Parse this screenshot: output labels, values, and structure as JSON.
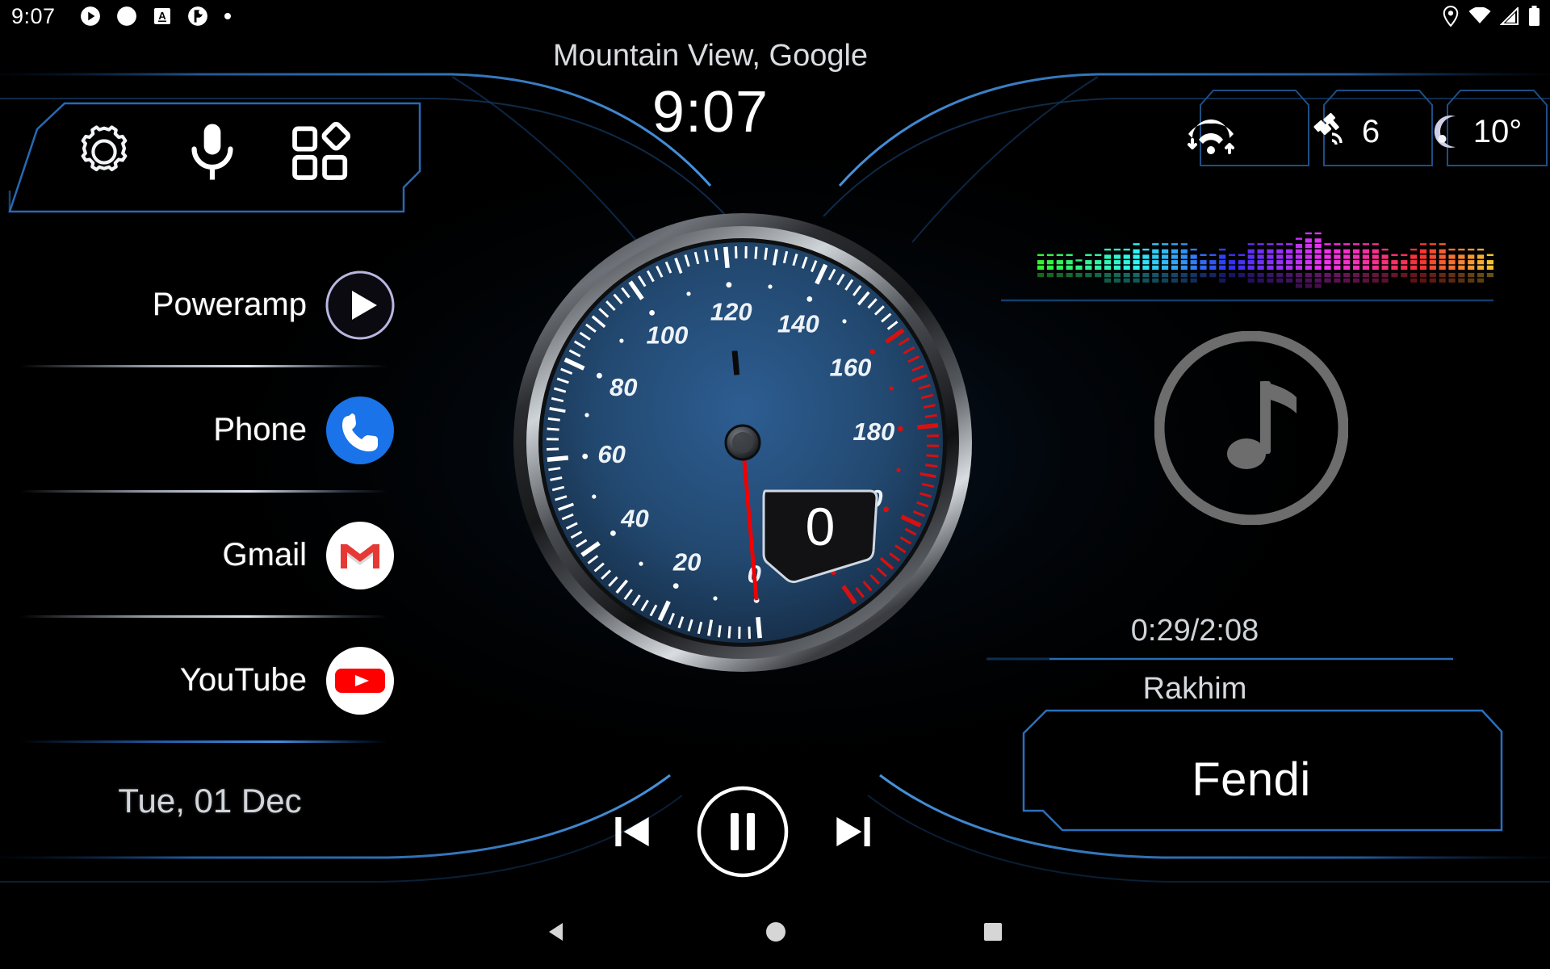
{
  "statusbar": {
    "clock": "9:07",
    "left_icons": [
      "play-circle-icon",
      "circle-icon",
      "android-auto-icon",
      "poweramp-icon",
      "dot-icon"
    ],
    "right_icons": [
      "location-pin-icon",
      "wifi-icon",
      "cell-signal-icon",
      "battery-icon"
    ]
  },
  "header": {
    "location": "Mountain View, Google",
    "clock": "9:07"
  },
  "quick_panel": {
    "icons": [
      {
        "name": "settings-gear-icon",
        "label": "Settings"
      },
      {
        "name": "microphone-icon",
        "label": "Voice"
      },
      {
        "name": "apps-grid-icon",
        "label": "Apps"
      }
    ]
  },
  "apps": [
    {
      "label": "Poweramp",
      "icon": "poweramp-play-icon"
    },
    {
      "label": "Phone",
      "icon": "phone-icon"
    },
    {
      "label": "Gmail",
      "icon": "gmail-icon"
    },
    {
      "label": "YouTube",
      "icon": "youtube-icon"
    }
  ],
  "date": "Tue, 01 Dec",
  "status_widgets": [
    {
      "name": "wifi-data-widget",
      "icon": "wifi-arrows-icon",
      "value": ""
    },
    {
      "name": "gps-widget",
      "icon": "satellite-icon",
      "value": "6"
    },
    {
      "name": "weather-widget",
      "icon": "moon-icon",
      "value": "10°"
    }
  ],
  "gauge": {
    "digital_value": "0",
    "unit": "",
    "needle_value": 0,
    "min": 0,
    "max": 220,
    "redline_start": 160,
    "labels": [
      "0",
      "20",
      "40",
      "60",
      "80",
      "100",
      "120",
      "140",
      "160",
      "180",
      "200"
    ]
  },
  "player": {
    "time": "0:29/2:08",
    "artist": "Rakhim",
    "title": "Fendi",
    "album_art_icon": "music-note-icon",
    "controls": [
      {
        "name": "previous-track-button",
        "icon": "skip-previous-icon"
      },
      {
        "name": "play-pause-button",
        "icon": "pause-icon"
      },
      {
        "name": "next-track-button",
        "icon": "skip-next-icon"
      }
    ]
  },
  "navbar": [
    {
      "name": "nav-back-button",
      "icon": "back-triangle-icon"
    },
    {
      "name": "nav-home-button",
      "icon": "home-circle-icon"
    },
    {
      "name": "nav-recents-button",
      "icon": "recents-square-icon"
    }
  ],
  "colors": {
    "accent_blue": "#2f7fd4",
    "gauge_face": "#1e3a5f",
    "redline": "#d81010",
    "needle": "#f20000",
    "phone_blue": "#1a73e8",
    "gmail_red": "#e53935",
    "youtube_red": "#ff0000"
  }
}
